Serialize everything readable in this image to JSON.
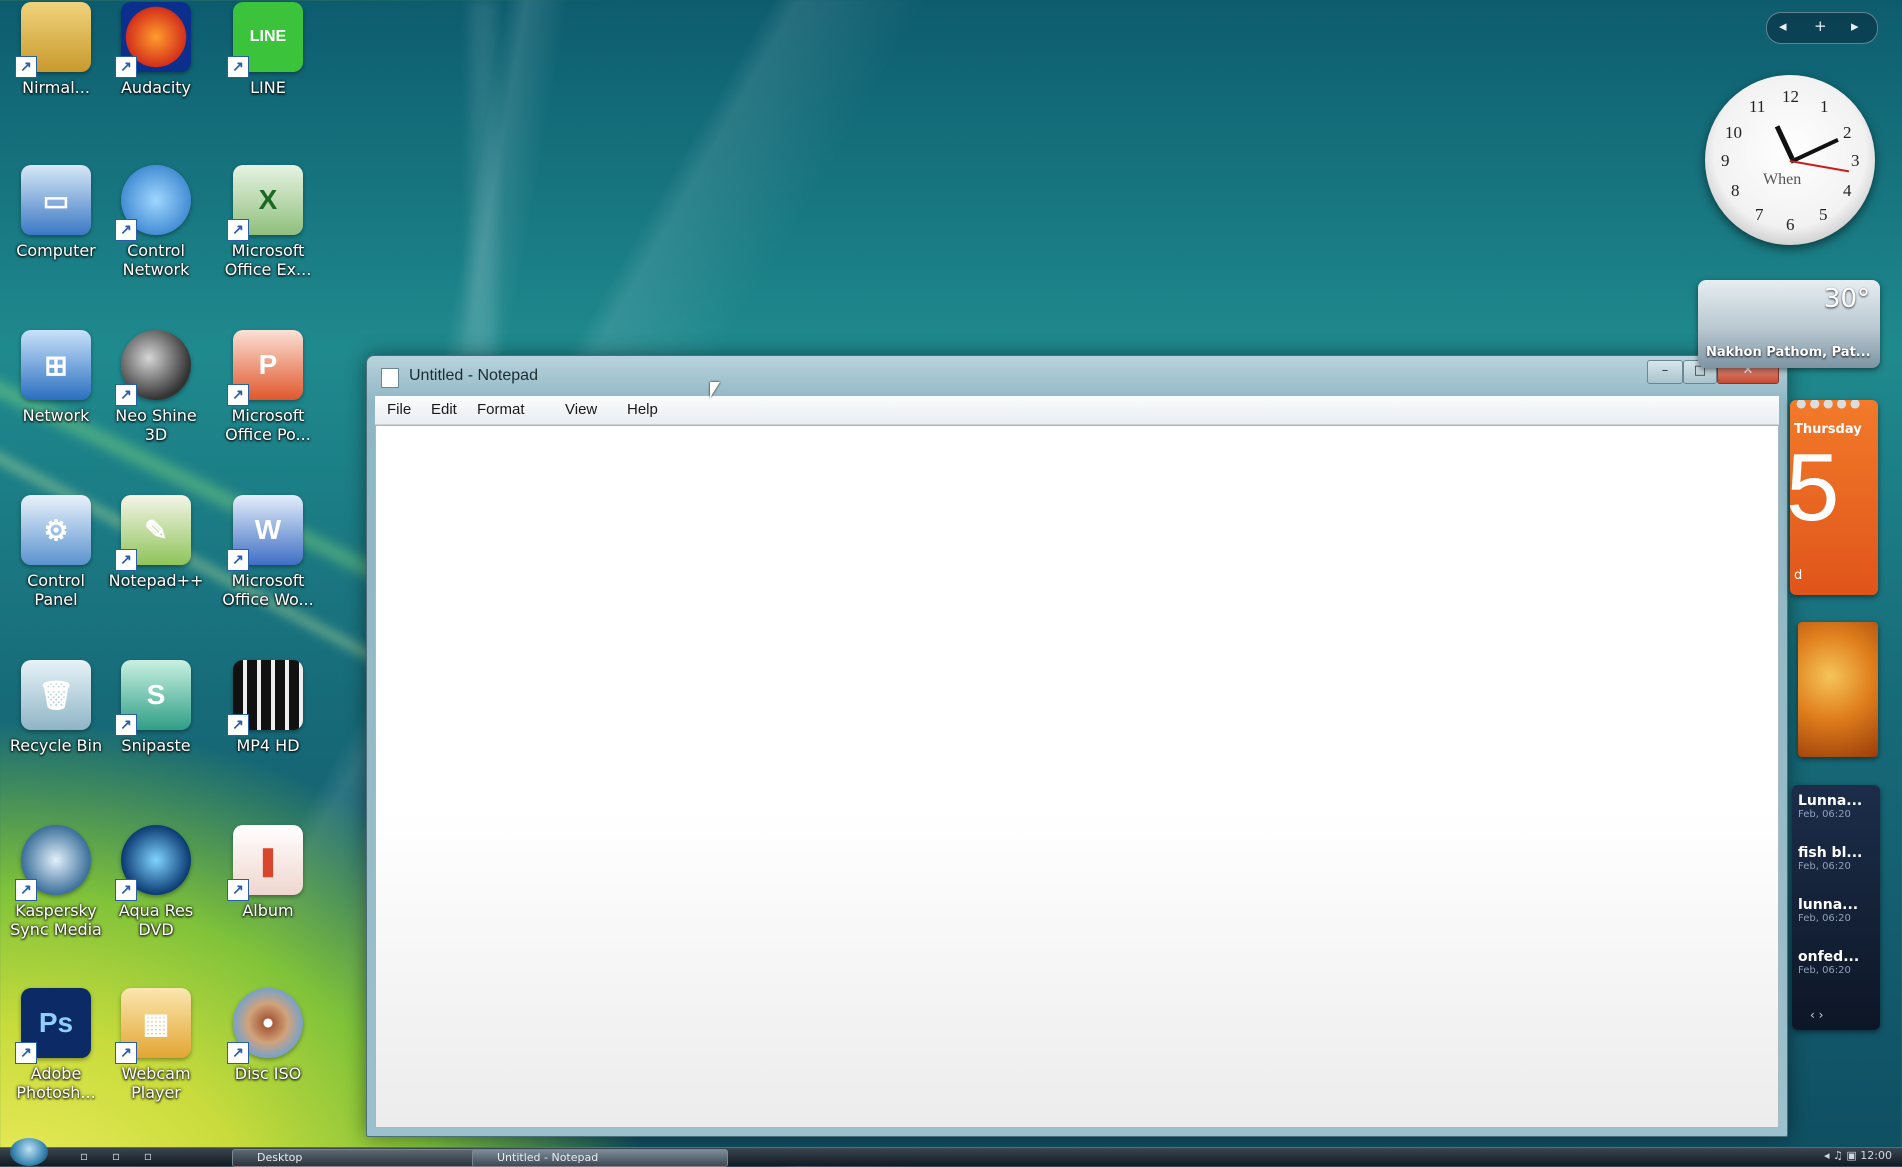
{
  "desktop": {
    "icons": [
      {
        "label": "Nirmal..."
      },
      {
        "label": "Audacity"
      },
      {
        "label": "LINE"
      },
      {
        "label": "Computer"
      },
      {
        "label": "Control\nNetwork"
      },
      {
        "label": "Microsoft\nOffice Ex..."
      },
      {
        "label": "Network"
      },
      {
        "label": "Neo Shine\n3D"
      },
      {
        "label": "Microsoft\nOffice Po..."
      },
      {
        "label": "Control\nPanel"
      },
      {
        "label": "Notepad++"
      },
      {
        "label": "Microsoft\nOffice Wo..."
      },
      {
        "label": "Recycle Bin"
      },
      {
        "label": "Snipaste"
      },
      {
        "label": "MP4 HD"
      },
      {
        "label": "Kaspersky\nSync Media"
      },
      {
        "label": "Aqua Res\nDVD"
      },
      {
        "label": "Album"
      },
      {
        "label": "Adobe\nPhotosh..."
      },
      {
        "label": "Webcam\nPlayer"
      },
      {
        "label": "Disc ISO"
      }
    ]
  },
  "notepad": {
    "title": "Untitled - Notepad",
    "menu": [
      "File",
      "Edit",
      "Format",
      "View",
      "Help"
    ],
    "controls": {
      "minimize": "–",
      "maximize": "□",
      "close": "✕"
    },
    "content": ""
  },
  "sidebar": {
    "controls": {
      "prev": "◂",
      "add": "+",
      "next": "▸"
    },
    "clock": {
      "numbers": [
        "12",
        "1",
        "2",
        "3",
        "4",
        "5",
        "6",
        "7",
        "8",
        "9",
        "10",
        "11"
      ],
      "label": "When"
    },
    "weather": {
      "temperature": "30°",
      "location": "Nakhon Pathom, Pat..."
    },
    "calendar": {
      "day_name": "Thursday",
      "date": "5",
      "month": "d"
    },
    "feed": [
      {
        "title": "Lunna...",
        "sub": "Feb, 06:20"
      },
      {
        "title": "fish bl...",
        "sub": "Feb, 06:20"
      },
      {
        "title": "lunna...",
        "sub": "Feb, 06:20"
      },
      {
        "title": "onfed...",
        "sub": "Feb, 06:20"
      }
    ],
    "feed_nav": "‹  ›"
  },
  "taskbar": {
    "quick_launch": "▫ ▫ ▫",
    "desktop_button": "Desktop",
    "notepad_button": "Untitled - Notepad",
    "tray": "◂ ♫ ▣  12:00"
  },
  "colors": {
    "wallpaper_teal": "#1f8a8e",
    "wallpaper_yellow": "#f3ee62",
    "calendar_orange": "#e0551a",
    "close_red": "#c44a33"
  }
}
